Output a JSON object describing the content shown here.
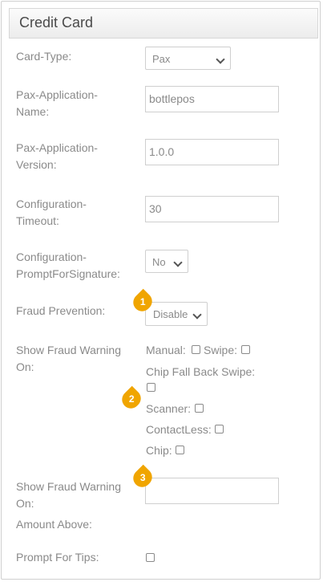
{
  "panel": {
    "title": "Credit Card"
  },
  "labels": {
    "card_type": "Card-Type:",
    "pax_app_name_1": "Pax-Application-",
    "pax_app_name_2": "Name:",
    "pax_app_version_1": "Pax-Application-",
    "pax_app_version_2": "Version:",
    "config_timeout_1": "Configuration-",
    "config_timeout_2": "Timeout:",
    "config_prompt_1": "Configuration-",
    "config_prompt_2": "PromptForSignature:",
    "fraud_prevention": "Fraud Prevention:",
    "show_fraud_1": "Show Fraud Warning",
    "show_fraud_2": "On:",
    "show_fraud_amount_1": "Show Fraud Warning",
    "show_fraud_amount_2": "On:",
    "show_fraud_amount_3": "Amount Above:",
    "prompt_tips": "Prompt For Tips:"
  },
  "fields": {
    "card_type": "Pax",
    "pax_app_name": "bottlepos",
    "pax_app_version": "1.0.0",
    "config_timeout": "30",
    "config_prompt": "No",
    "fraud_prevention": "Disable",
    "amount_above": ""
  },
  "fraud_options": {
    "manual": "Manual:",
    "swipe": "Swipe:",
    "chip_fallback": "Chip Fall Back Swipe:",
    "scanner": "Scanner:",
    "contactless": "ContactLess:",
    "chip": "Chip:"
  },
  "badges": [
    "1",
    "2",
    "3"
  ],
  "colors": {
    "badge": "#f0a500",
    "label_text": "#8a8a8a"
  }
}
